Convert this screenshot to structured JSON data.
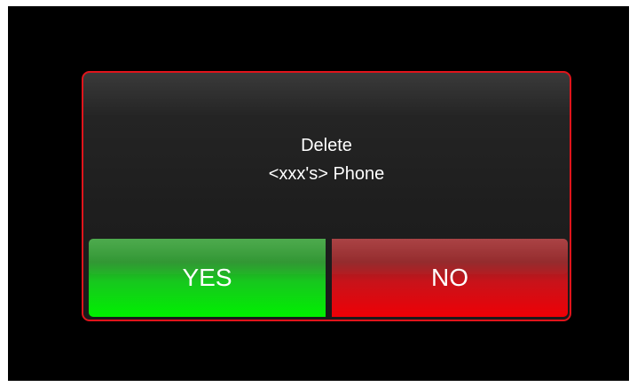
{
  "dialog": {
    "message_line1": "Delete",
    "message_line2": "<xxx's> Phone",
    "yes_label": "YES",
    "no_label": "NO"
  },
  "colors": {
    "background": "#000000",
    "dialog_border": "#e0141b",
    "yes_button": "#00f000",
    "no_button": "#ee0006",
    "text": "#ffffff"
  }
}
